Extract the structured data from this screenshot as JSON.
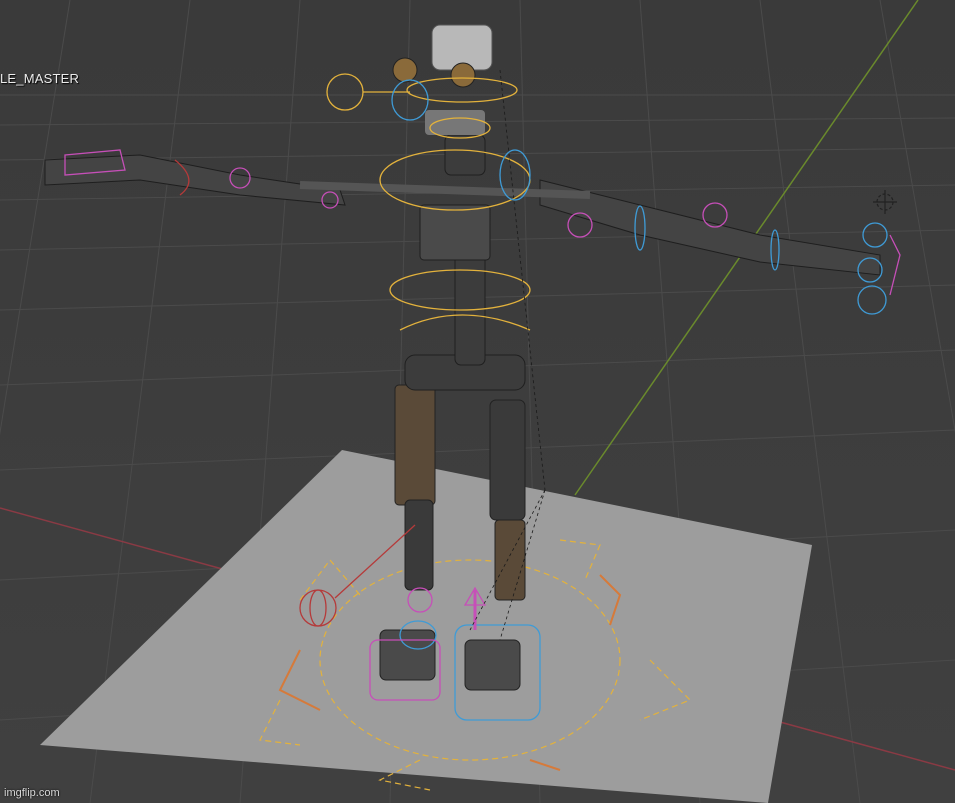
{
  "viewport": {
    "object_label": "LE_MASTER",
    "watermark": "imgflip.com"
  },
  "colors": {
    "grid": "#4a4a4a",
    "x_axis": "#8a3a44",
    "y_axis": "#6a8a2c",
    "ground_plane": "#9d9d9d",
    "robot_metal": "#3c3c3c",
    "bone_yellow": "#e3b23c",
    "bone_blue": "#3f9bd6",
    "bone_pink": "#c64fb8",
    "bone_red": "#b53a3a",
    "bone_orange": "#d67a3a"
  },
  "icons": {
    "empty_object": "empty-object-icon"
  }
}
